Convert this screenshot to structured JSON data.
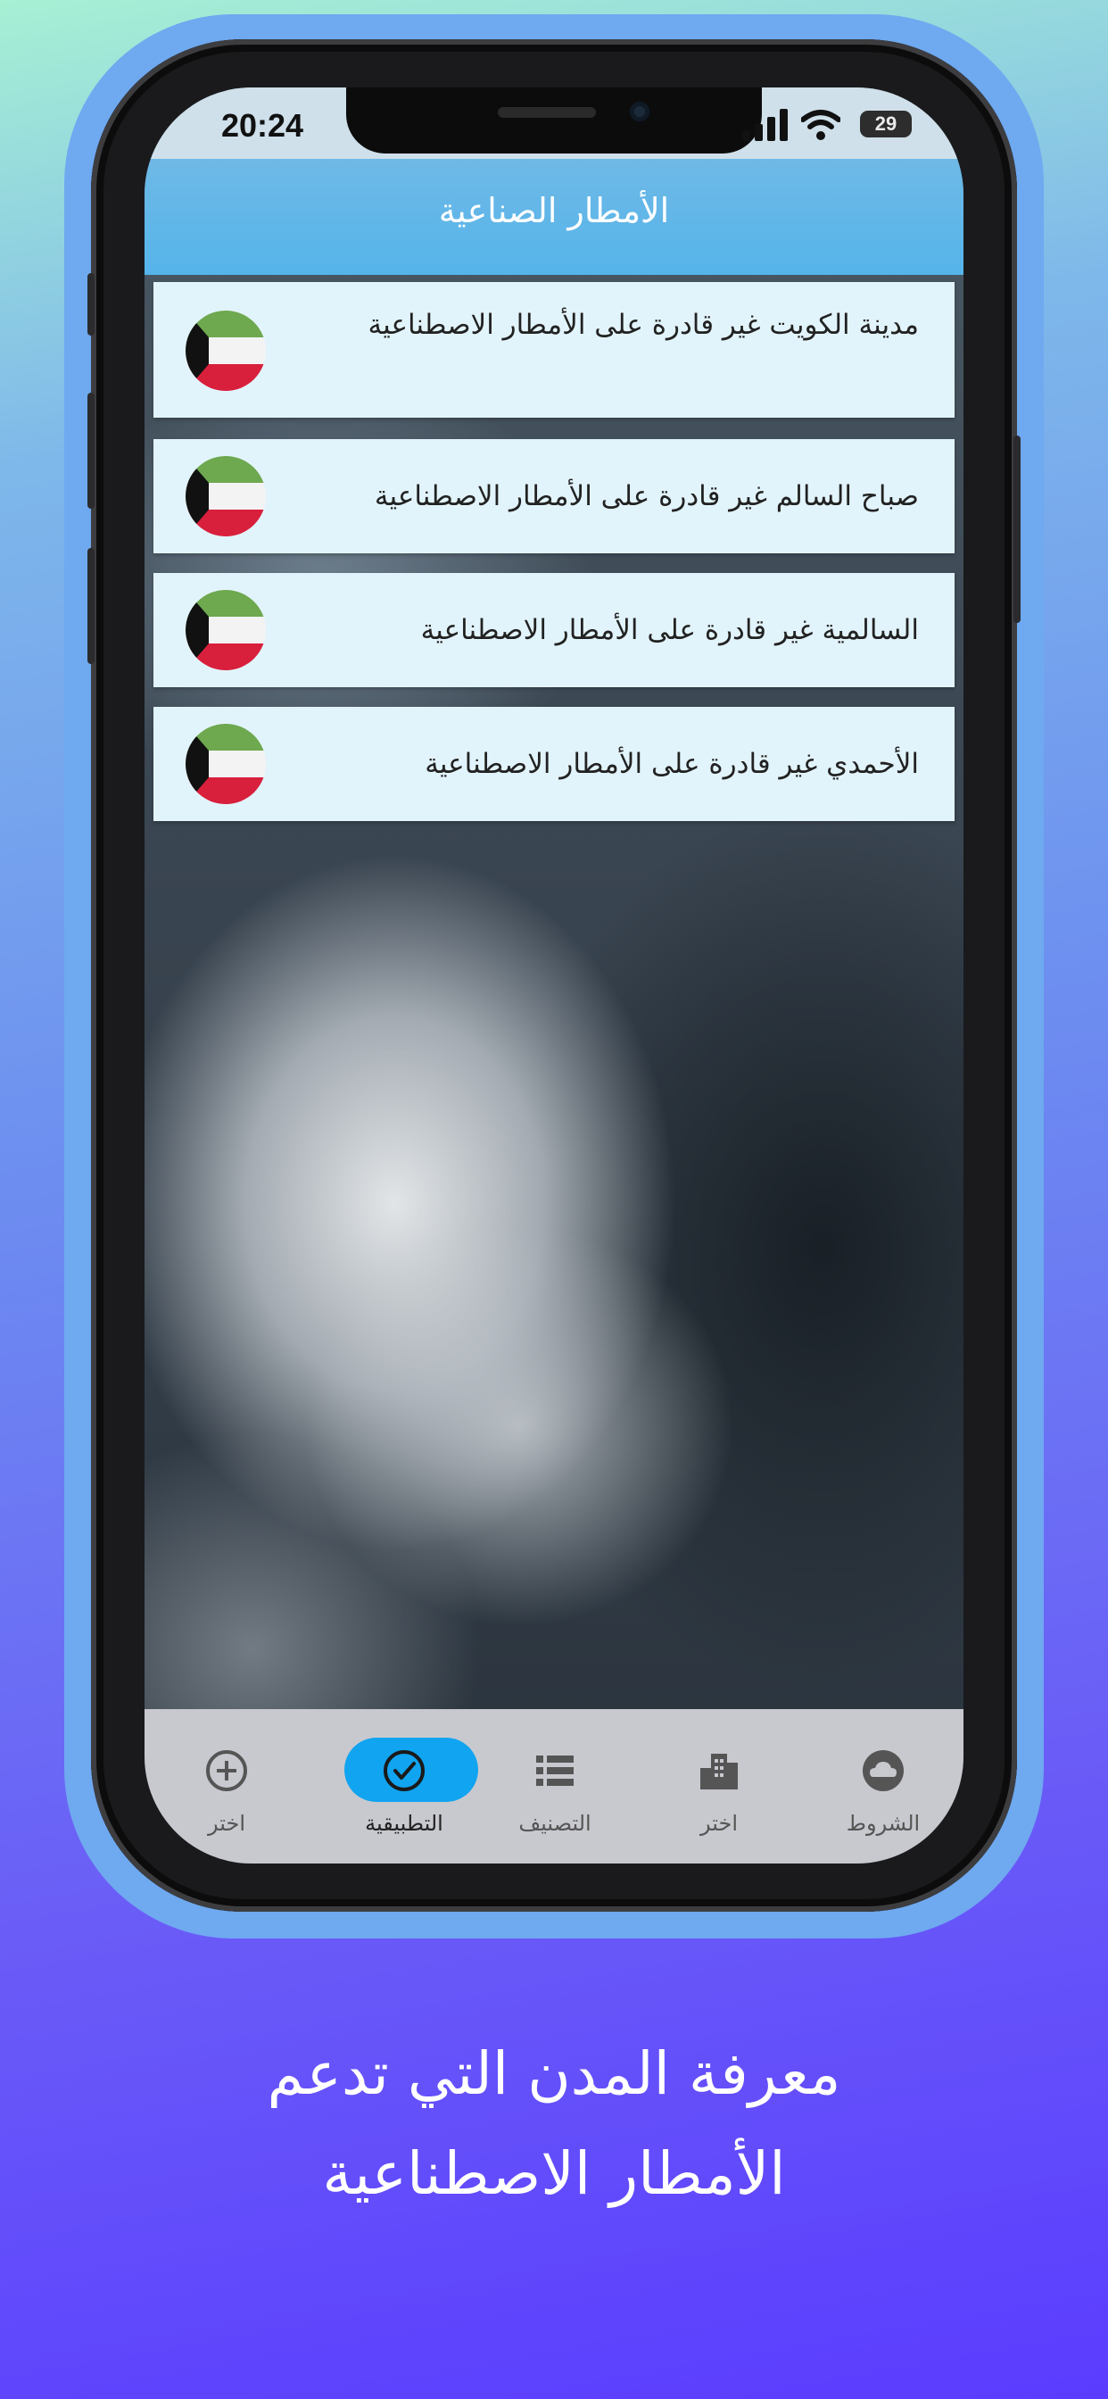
{
  "status_bar": {
    "time": "20:24",
    "battery": "29"
  },
  "header": {
    "title": "الأمطار الصناعية"
  },
  "cities": [
    {
      "text": "مدينة الكويت غير قادرة على الأمطار الاصطناعية",
      "flag": "kuwait-flag"
    },
    {
      "text": "صباح السالم غير قادرة على الأمطار الاصطناعية",
      "flag": "kuwait-flag"
    },
    {
      "text": "السالمية غير قادرة على الأمطار الاصطناعية",
      "flag": "kuwait-flag"
    },
    {
      "text": "الأحمدي غير قادرة على الأمطار الاصطناعية",
      "flag": "kuwait-flag"
    }
  ],
  "tabs": [
    {
      "label": "اختر",
      "icon": "add-circle-icon",
      "active": false
    },
    {
      "label": "التطبيقية",
      "icon": "check-circle-icon",
      "active": true
    },
    {
      "label": "التصنيف",
      "icon": "list-icon",
      "active": false
    },
    {
      "label": "اختر",
      "icon": "city-icon",
      "active": false
    },
    {
      "label": "الشروط",
      "icon": "cloud-icon",
      "active": false
    }
  ],
  "caption": {
    "line1": "معرفة المدن التي تدعم",
    "line2": "الأمطار الاصطناعية"
  },
  "colors": {
    "header": "#55b4ea",
    "list_item_bg": "#e2f4fb",
    "tab_active": "#11a4f0",
    "tabbar_bg": "#c8c9cf"
  }
}
